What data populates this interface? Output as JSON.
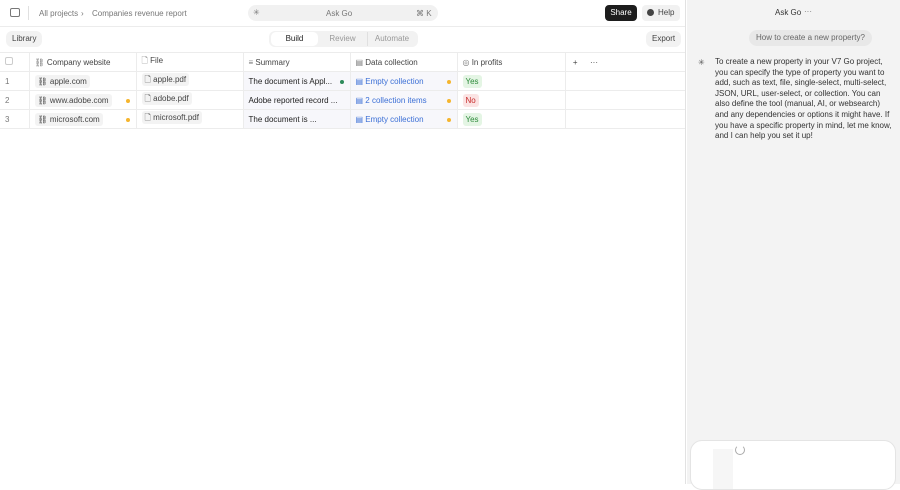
{
  "topbar": {
    "breadcrumb": [
      "All projects",
      "Companies revenue report"
    ],
    "ask_label": "Ask Go",
    "shortcut": "⌘ K",
    "share": "Share",
    "help": "Help"
  },
  "toolbar": {
    "library": "Library",
    "tabs": [
      "Build",
      "Review",
      "Automate"
    ],
    "active_tab": "Build",
    "export": "Export"
  },
  "table": {
    "columns": [
      "Company website",
      "File",
      "Summary",
      "Data collection",
      "In profits"
    ],
    "rows": [
      {
        "num": "1",
        "website": "apple.com",
        "file": "apple.pdf",
        "summary": "The document is Appl...",
        "collection": "Empty collection",
        "profits": "Yes"
      },
      {
        "num": "2",
        "website": "www.adobe.com",
        "file": "adobe.pdf",
        "summary": "Adobe reported record ...",
        "collection": "2 collection items",
        "profits": "No"
      },
      {
        "num": "3",
        "website": "microsoft.com",
        "file": "microsoft.pdf",
        "summary": "The document is ...",
        "collection": "Empty collection",
        "profits": "Yes"
      }
    ]
  },
  "chat": {
    "title": "Ask Go",
    "question": "How to create a new property?",
    "answer": "To create a new property in your V7 Go project, you can specify the type of property you want to add, such as text, file, single-select, multi-select, JSON, URL, user-select, or collection. You can also define the tool (manual, AI, or websearch) and any dependencies or options it might have. If you have a specific property in mind, let me know, and I can help you set it up!"
  },
  "colors": {
    "accent": "#3b6fd6",
    "pending": "#f5b52e",
    "done": "#2d8a5a"
  }
}
